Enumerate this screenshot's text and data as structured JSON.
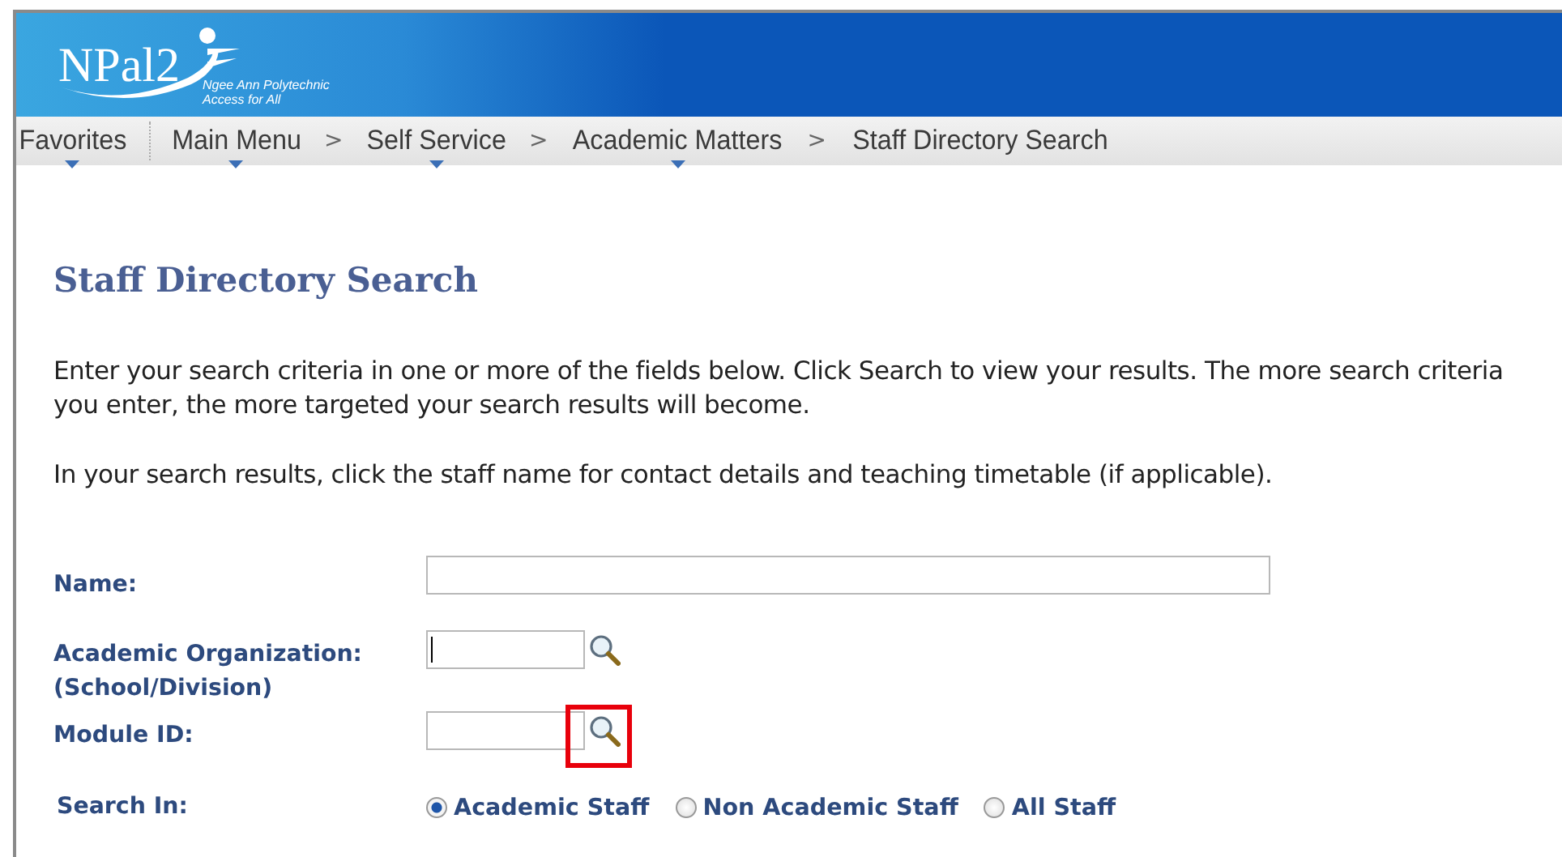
{
  "header": {
    "logo": "NPal2",
    "tagline": [
      "Ngee Ann Polytechnic",
      "Access for All"
    ]
  },
  "breadcrumb": [
    {
      "label": "Favorites",
      "menu": true
    },
    {
      "label": "Main Menu",
      "menu": true
    },
    {
      "label": "Self Service",
      "menu": true
    },
    {
      "label": "Academic Matters",
      "menu": true
    },
    {
      "label": "Staff Directory Search",
      "menu": false
    }
  ],
  "breadcrumb_separator": ">",
  "page_title": "Staff Directory Search",
  "instructions": [
    [
      "Enter your search criteria in one or more of the fields below. Click Search to view your results. The more search criteria",
      "you enter, the more targeted your search results will become."
    ],
    [
      "In your search results, click the staff name for contact details and teaching timetable (if applicable)."
    ]
  ],
  "fields": [
    {
      "kind": "text",
      "label": [
        "Name:"
      ],
      "focused": false
    },
    {
      "kind": "lookup",
      "label": [
        "Academic Organization:",
        "(School/Division)"
      ],
      "focused": true
    },
    {
      "kind": "lookup",
      "label": [
        "Module ID:"
      ],
      "focused": false
    }
  ],
  "search_in": {
    "label": "Search In:",
    "options": [
      {
        "label": "Academic Staff",
        "selected": true
      },
      {
        "label": "Non Academic Staff",
        "selected": false
      },
      {
        "label": "All Staff",
        "selected": false
      }
    ]
  }
}
